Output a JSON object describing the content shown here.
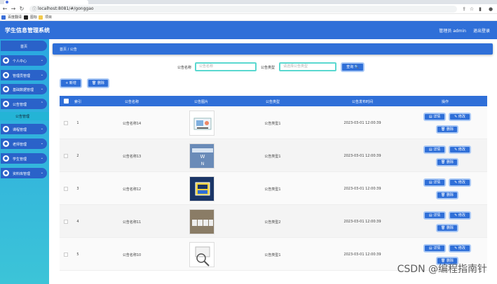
{
  "browser": {
    "tab_title": "",
    "url": "localhost:8081/#/gonggao",
    "bookmarks": [
      {
        "label": "百度翻译",
        "color": "#3b6fd8"
      },
      {
        "label": "图标",
        "color": "#222222"
      },
      {
        "label": "项目",
        "color": "#f2c94c"
      }
    ]
  },
  "header": {
    "title": "学生信息管理系统",
    "admin": "管理员 admin",
    "logout": "退出登录"
  },
  "sidebar": {
    "home": "首页",
    "items": [
      {
        "label": "个人中心",
        "icon": "user-icon"
      },
      {
        "label": "管理员管理",
        "icon": "admin-icon"
      },
      {
        "label": "基础数据管理",
        "icon": "data-icon"
      },
      {
        "label": "公告管理",
        "icon": "notice-icon"
      }
    ],
    "sub_item": "公告管理",
    "items_after": [
      {
        "label": "课程管理",
        "icon": "course-icon"
      },
      {
        "label": "老师管理",
        "icon": "teacher-icon"
      },
      {
        "label": "学生管理",
        "icon": "student-icon"
      },
      {
        "label": "资料库管理",
        "icon": "library-icon"
      }
    ]
  },
  "breadcrumb": "首页 / 公告",
  "filters": {
    "name_label": "公告名称",
    "name_placeholder": "公告名称",
    "type_label": "公告类型",
    "type_placeholder": "请选择公告类型",
    "search_button": "查询 🔍"
  },
  "toolbar": {
    "add": "+ 新增",
    "delete": "🗑 删除"
  },
  "table": {
    "headers": [
      "索引",
      "公告名称",
      "公告图片",
      "公告类型",
      "公告发布时间",
      "操作"
    ],
    "rows": [
      {
        "index": "1",
        "name": "公告名称14",
        "type": "公告类型1",
        "time": "2023-03-01 12:00:39"
      },
      {
        "index": "2",
        "name": "公告名称13",
        "type": "公告类型1",
        "time": "2023-03-01 12:00:39"
      },
      {
        "index": "3",
        "name": "公告名称12",
        "type": "公告类型1",
        "time": "2023-03-01 12:00:39"
      },
      {
        "index": "4",
        "name": "公告名称11",
        "type": "公告类型2",
        "time": "2023-03-01 12:00:39"
      },
      {
        "index": "5",
        "name": "公告名称10",
        "type": "公告类型1",
        "time": "2023-03-01 12:00:39"
      }
    ],
    "ops": {
      "detail": "详情",
      "edit": "修改",
      "delete": "删除"
    }
  },
  "watermark": "CSDN @编程指南针"
}
